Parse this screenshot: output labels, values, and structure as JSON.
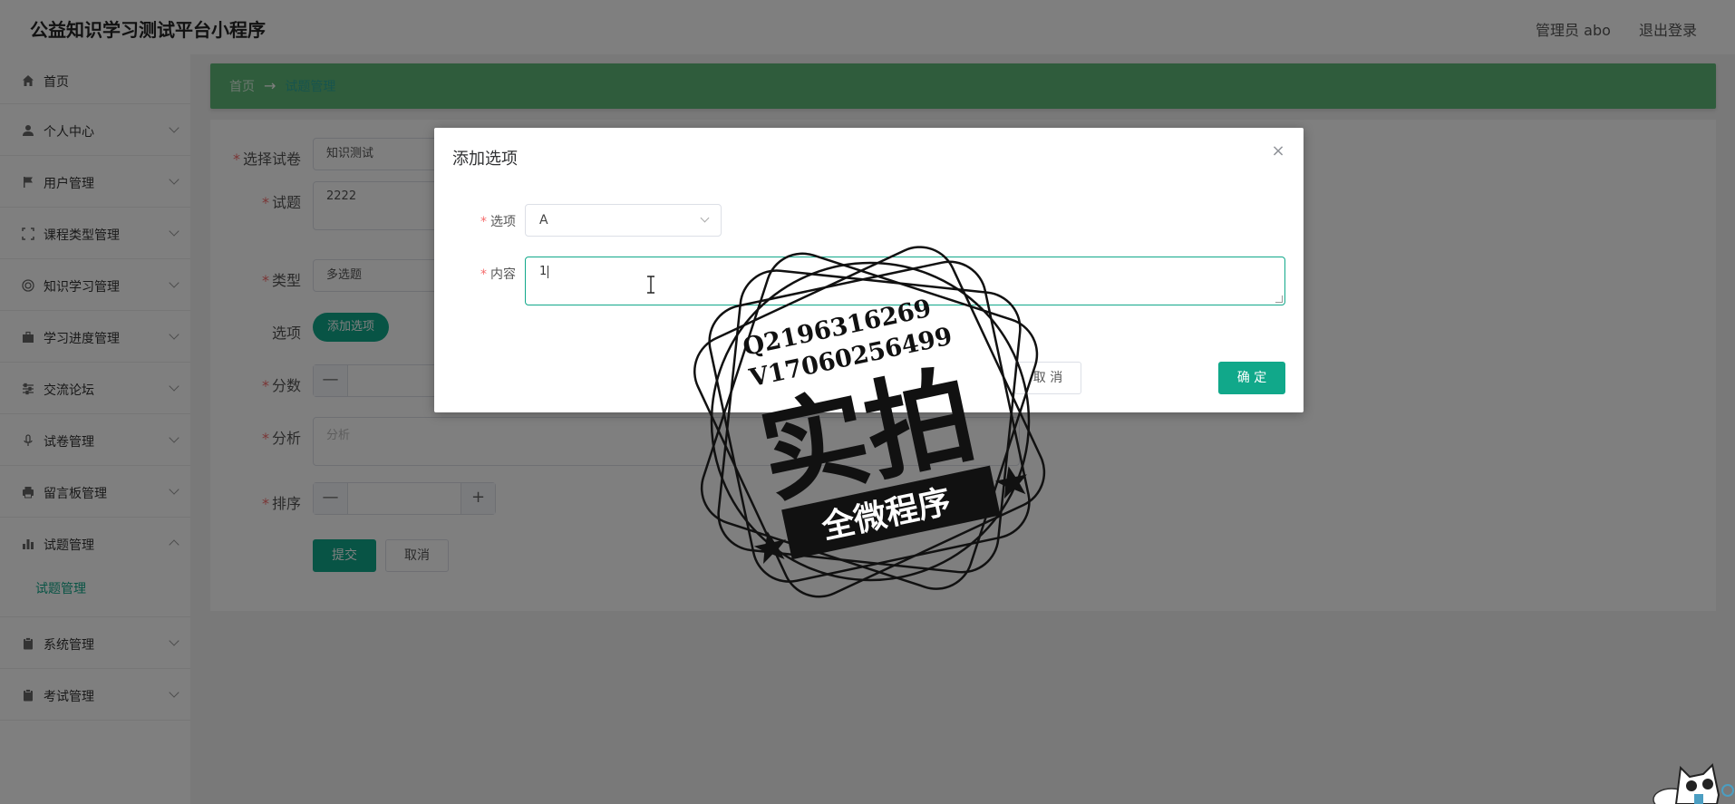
{
  "header": {
    "app_title": "公益知识学习测试平台小程序",
    "admin_label": "管理员 abo",
    "logout_label": "退出登录"
  },
  "sidebar": {
    "items": [
      {
        "label": "首页",
        "icon": "home-icon"
      },
      {
        "label": "个人中心",
        "icon": "user-icon"
      },
      {
        "label": "用户管理",
        "icon": "flag-icon"
      },
      {
        "label": "课程类型管理",
        "icon": "frame-icon"
      },
      {
        "label": "知识学习管理",
        "icon": "target-icon"
      },
      {
        "label": "学习进度管理",
        "icon": "briefcase-icon"
      },
      {
        "label": "交流论坛",
        "icon": "sliders-icon"
      },
      {
        "label": "试卷管理",
        "icon": "mic-icon"
      },
      {
        "label": "留言板管理",
        "icon": "printer-icon"
      },
      {
        "label": "试题管理",
        "icon": "bar-chart-icon"
      },
      {
        "label": "系统管理",
        "icon": "clipboard-icon"
      },
      {
        "label": "考试管理",
        "icon": "clipboard-icon"
      }
    ],
    "sub_item": "试题管理"
  },
  "breadcrumb": {
    "home": "首页",
    "arrow": "→",
    "current": "试题管理"
  },
  "form": {
    "paper_label": "选择试卷",
    "paper_value": "知识测试",
    "question_label": "试题",
    "question_value": "2222",
    "type_label": "类型",
    "type_value": "多选题",
    "options_label": "选项",
    "add_option_button": "添加选项",
    "score_label": "分数",
    "analysis_label": "分析",
    "analysis_placeholder": "分析",
    "order_label": "排序",
    "minus": "—",
    "plus": "+",
    "submit_button": "提交",
    "cancel_button": "取消"
  },
  "dialog": {
    "title": "添加选项",
    "close": "×",
    "option_label": "选项",
    "option_value": "A",
    "content_label": "内容",
    "content_value": "1",
    "cancel_button": "取 消",
    "confirm_button": "确 定"
  },
  "watermark": {
    "line1": "Q2196316269",
    "line2": "V17060256499",
    "big_text": "实拍",
    "banner_text": "全微程序"
  },
  "colors": {
    "accent": "#11a88a",
    "breadcrumb_bg": "#5fb878",
    "required": "#f56c6c"
  }
}
